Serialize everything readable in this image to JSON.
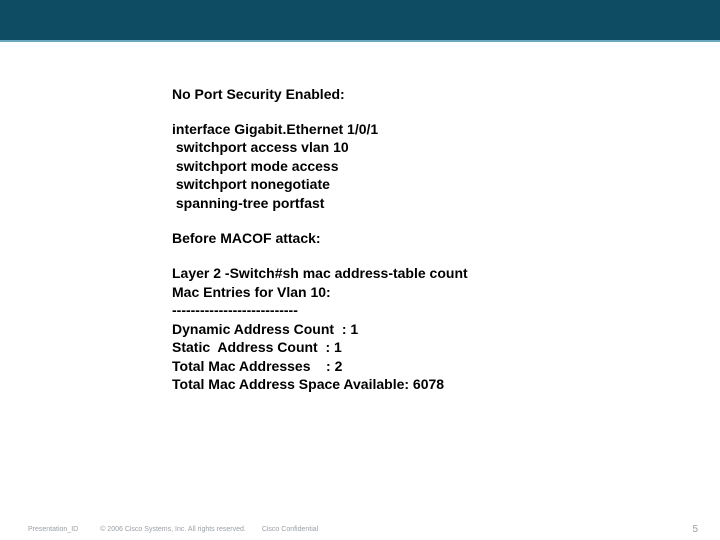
{
  "content": {
    "heading": "No Port Security Enabled:",
    "interface_block": "interface Gigabit.Ethernet 1/0/1\n switchport access vlan 10\n switchport mode access\n switchport nonegotiate\n spanning-tree portfast",
    "before_heading": "Before MACOF attack:",
    "mac_block": "Layer 2 -Switch#sh mac address-table count\nMac Entries for Vlan 10:\n---------------------------\nDynamic Address Count  : 1\nStatic  Address Count  : 1\nTotal Mac Addresses    : 2\nTotal Mac Address Space Available: 6078"
  },
  "footer": {
    "presentation_id": "Presentation_ID",
    "copyright": "© 2006 Cisco Systems, Inc. All rights reserved.",
    "confidential": "Cisco Confidential",
    "page": "5"
  }
}
